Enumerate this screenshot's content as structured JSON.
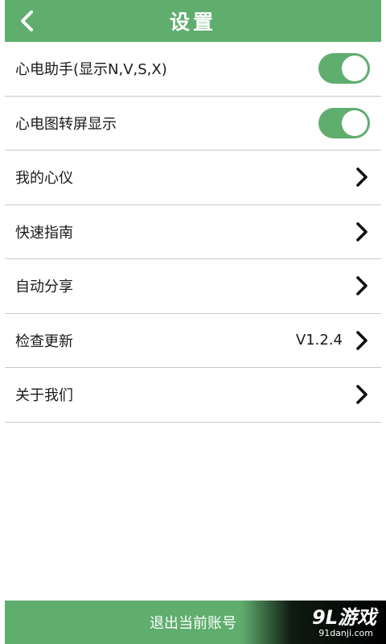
{
  "header": {
    "title": "设置",
    "back_icon": "chevron-left-icon"
  },
  "settings": [
    {
      "label": "心电助手(显示N,V,S,X)",
      "control": "toggle",
      "on": true
    },
    {
      "label": "心电图转屏显示",
      "control": "toggle",
      "on": true
    },
    {
      "label": "我的心仪",
      "control": "chevron"
    },
    {
      "label": "快速指南",
      "control": "chevron"
    },
    {
      "label": "自动分享",
      "control": "chevron"
    },
    {
      "label": "检查更新",
      "control": "chevron",
      "value": "V1.2.4"
    },
    {
      "label": "关于我们",
      "control": "chevron"
    }
  ],
  "footer": {
    "logout_label": "退出当前账号"
  },
  "watermark": {
    "main": "9L游戏",
    "sub": "91danji.com"
  },
  "colors": {
    "accent": "#5fae6e",
    "divider": "#c8c8c8",
    "text": "#1a1a1a"
  }
}
